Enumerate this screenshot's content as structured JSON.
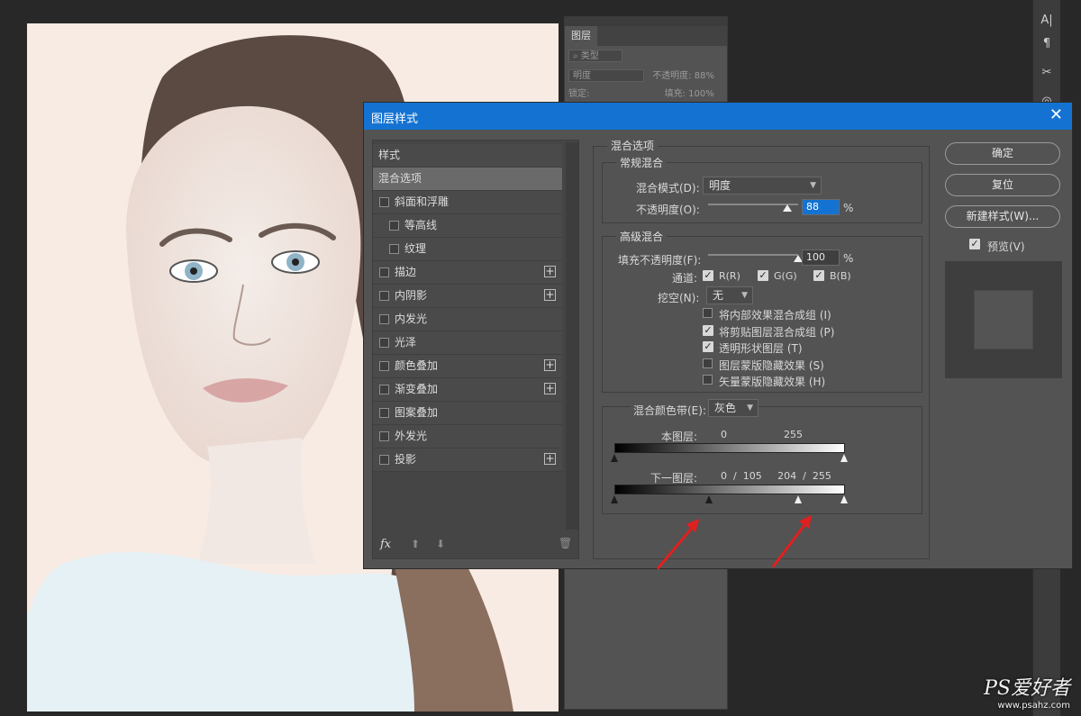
{
  "layers_panel": {
    "tab": "图层",
    "kind_filter": "类型",
    "blend_mode": "明度",
    "opacity_label": "不透明度:",
    "opacity_value": "88%",
    "lock_label": "锁定:",
    "fill_label": "填充:",
    "fill_value": "100%"
  },
  "dialog": {
    "title": "图层样式",
    "close_label": "✕",
    "styles_header": "样式",
    "style_items": [
      {
        "label": "混合选项",
        "selected": true
      },
      {
        "label": "斜面和浮雕",
        "checkbox": true
      },
      {
        "label": "等高线",
        "checkbox": true,
        "indent": true
      },
      {
        "label": "纹理",
        "checkbox": true,
        "indent": true
      },
      {
        "label": "描边",
        "checkbox": true,
        "plus": true
      },
      {
        "label": "内阴影",
        "checkbox": true,
        "plus": true
      },
      {
        "label": "内发光",
        "checkbox": true
      },
      {
        "label": "光泽",
        "checkbox": true
      },
      {
        "label": "颜色叠加",
        "checkbox": true,
        "plus": true
      },
      {
        "label": "渐变叠加",
        "checkbox": true,
        "plus": true
      },
      {
        "label": "图案叠加",
        "checkbox": true
      },
      {
        "label": "外发光",
        "checkbox": true
      },
      {
        "label": "投影",
        "checkbox": true,
        "plus": true
      }
    ],
    "fx_label": "fx",
    "blending_options": {
      "section_title": "混合选项",
      "general": {
        "title": "常规混合",
        "mode_label": "混合模式(D):",
        "mode_value": "明度",
        "opacity_label": "不透明度(O):",
        "opacity_value": "88",
        "opacity_unit": "%",
        "opacity_level": 0.88
      },
      "advanced": {
        "title": "高级混合",
        "fill_label": "填充不透明度(F):",
        "fill_value": "100",
        "fill_unit": "%",
        "fill_level": 1.0,
        "channels_label": "通道:",
        "channels": [
          "R(R)",
          "G(G)",
          "B(B)"
        ],
        "knockout_label": "挖空(N):",
        "knockout_value": "无",
        "options": [
          {
            "label": "将内部效果混合成组 (I)",
            "checked": false
          },
          {
            "label": "将剪贴图层混合成组 (P)",
            "checked": true
          },
          {
            "label": "透明形状图层 (T)",
            "checked": true
          },
          {
            "label": "图层蒙版隐藏效果 (S)",
            "checked": false
          },
          {
            "label": "矢量蒙版隐藏效果 (H)",
            "checked": false
          }
        ]
      },
      "blend_if": {
        "label": "混合颜色带(E):",
        "value": "灰色",
        "this_layer_label": "本图层:",
        "this_layer_low": "0",
        "this_layer_high": "255",
        "underlying_label": "下一图层:",
        "underlying_values": "0  /  105     204  /  255",
        "underlying_stops": [
          0,
          105,
          204,
          255
        ]
      }
    },
    "buttons": {
      "ok": "确定",
      "reset": "复位",
      "new_style": "新建样式(W)...",
      "preview": "预览(V)"
    }
  },
  "watermark": {
    "brand": "PS爱好者",
    "url": "www.psahz.com"
  }
}
